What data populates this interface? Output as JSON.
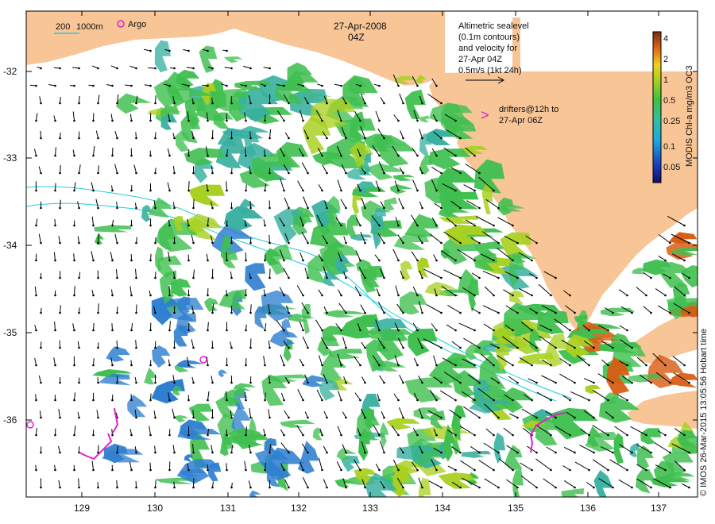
{
  "map": {
    "date": "27-Apr-2008",
    "time": "04Z",
    "scale_bar": {
      "label_a": "200",
      "label_b": "1000m"
    },
    "argo_label": "Argo",
    "altimetry_note": [
      "Altimetric sealevel",
      "(0.1m contours)",
      "and velocity for",
      "27-Apr 04Z",
      "0.5m/s (1kt 24h)"
    ],
    "drifter_note": [
      "drifters@12h to",
      "27-Apr 06Z"
    ],
    "drifter_glyph": ">",
    "colorbar": {
      "title": "MODIS Chl-a mg/m3 OC3",
      "ticks": [
        "4",
        "2",
        "1",
        "0.5",
        "0.25",
        "0.1",
        "0.05"
      ]
    },
    "credit": "© IMOS 26-Mar-2015 13:05:56 Hobart time",
    "x_ticks": [
      "129",
      "130",
      "131",
      "132",
      "133",
      "134",
      "135",
      "136",
      "137"
    ],
    "y_ticks": [
      "-32",
      "-33",
      "-34",
      "-35",
      "-36"
    ],
    "colors": {
      "land": "#f8c597",
      "vector": "#000000",
      "contour": "#22ccdd",
      "drifter": "#e020d0",
      "chl_low": "#2f7fd0",
      "chl_mid": "#3fbf4f",
      "chl_high": "#a8d020",
      "chl_veryhigh": "#d85a10"
    }
  }
}
